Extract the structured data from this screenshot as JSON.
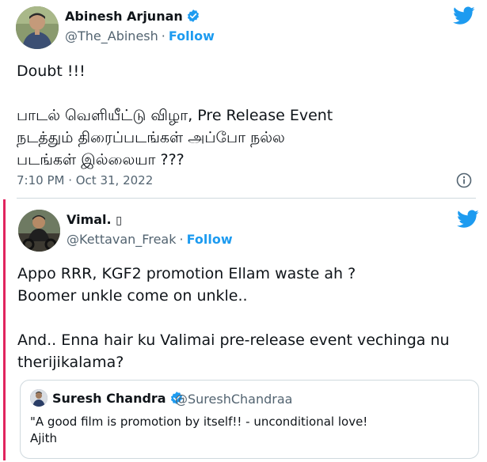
{
  "tweet": {
    "author_name": "Abinesh Arjunan",
    "handle": "@The_Abinesh",
    "separator": "·",
    "follow_label": "Follow",
    "body": [
      "Doubt !!!",
      "",
      "பாடல் வெளியீட்டு விழா, Pre Release Event",
      "நடத்தும் திரைப்படங்கள் அப்போ நல்ல",
      "படங்கள் இல்லையா ???"
    ],
    "timestamp": "7:10 PM · Oct 31, 2022",
    "info_icon": "info-icon",
    "brand_icon": "twitter-bird-icon"
  },
  "reply": {
    "author_name": "Vimal. ",
    "author_glyph": "▯",
    "handle": "@Kettavan_Freak",
    "separator": "·",
    "follow_label": "Follow",
    "body": [
      "Appo RRR, KGF2 promotion Ellam waste ah ?",
      "Boomer unkle come on unkle..",
      "",
      "And.. Enna hair ku Valimai pre-release event vechinga nu",
      "therijikalama?"
    ],
    "brand_icon": "twitter-bird-icon"
  },
  "quoted": {
    "author_name": "Suresh Chandra",
    "handle": "@SureshChandraa",
    "body": [
      "\"A good film is promotion by itself!! - unconditional love!",
      "Ajith"
    ]
  },
  "colors": {
    "accent": "#1d9bf0",
    "text": "#0f1419",
    "muted": "#536471",
    "border": "#cfd9de",
    "reply_bar": "#e0245e"
  }
}
